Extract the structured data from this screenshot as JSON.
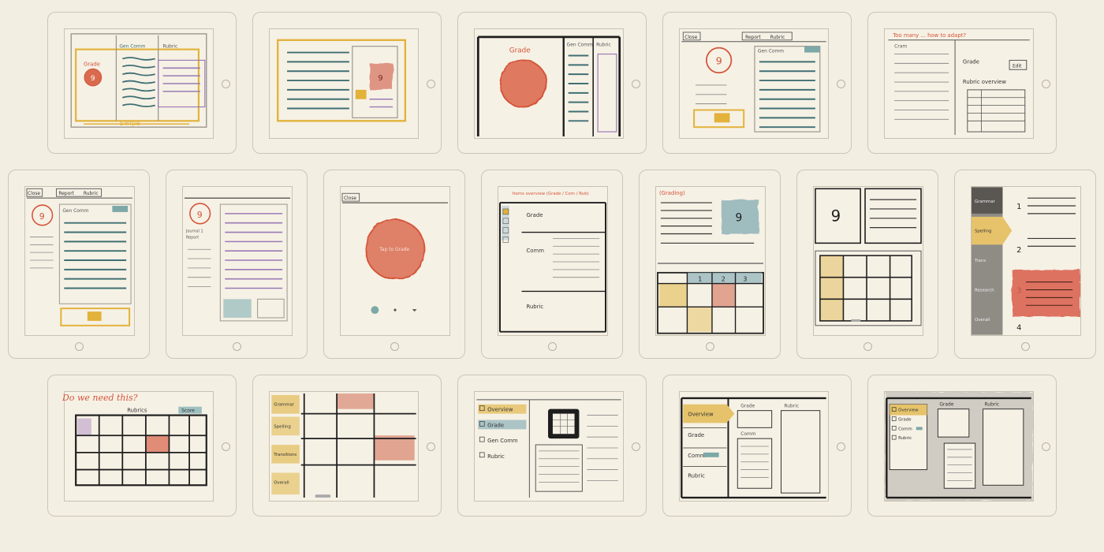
{
  "colors": {
    "background": "#f3eee2",
    "ink": "#2a2a2a",
    "pencil": "#9b968c",
    "teal": "#3f6f73",
    "red": "#d4553a",
    "yellow": "#e2b23a",
    "purple": "#9a7bb5"
  },
  "sketches": {
    "s1": {
      "grade": "Grade",
      "gencomm": "Gen Comm",
      "rubric": "Rubric",
      "score": "9",
      "swipe": "Swipe"
    },
    "s2": {
      "score": "9"
    },
    "s3": {
      "grade": "Grade",
      "gencomm": "Gen Comm",
      "rubric": "Rubric"
    },
    "s4": {
      "close": "Close",
      "report": "Report",
      "rubric": "Rubric",
      "score": "9",
      "gencomm": "Gen Comm"
    },
    "s5": {
      "title": "Too many ... how to adapt?",
      "cram": "Cram",
      "grade": "Grade",
      "edit": "Edit",
      "overview": "Rubric overview"
    },
    "s6": {
      "close": "Close",
      "report": "Report",
      "rubric": "Rubric",
      "score": "9",
      "gencomm": "Gen Comm"
    },
    "s7": {
      "score": "9",
      "tab1": "Journal 1",
      "tab2": "Report"
    },
    "s8": {
      "close": "Close",
      "bubble": "Tap to Grade"
    },
    "s9": {
      "title": "Items overview (Grade / Com / Rub)",
      "grade": "Grade",
      "comm": "Comm",
      "rubric": "Rubric"
    },
    "s10": {
      "title": "(Grading)",
      "score": "9",
      "c1": "1",
      "c2": "2",
      "c3": "3"
    },
    "s11": {
      "score": "9"
    },
    "s12": {
      "n1": "1",
      "n2": "2",
      "n3": "3",
      "n4": "4",
      "rows": [
        "Grammar",
        "Spelling",
        "Trans",
        "Research",
        "Overall"
      ]
    },
    "s13": {
      "question": "Do we need this?",
      "rubric": "Rubrics",
      "tab": "Score"
    },
    "s14": {
      "rows": [
        "Grammar",
        "Spelling",
        "Transitions",
        "Overall"
      ]
    },
    "s15": {
      "items": [
        "Overview",
        "Grade",
        "Gen Comm",
        "Rubric"
      ]
    },
    "s16": {
      "overview": "Overview",
      "grade": "Grade",
      "comm": "Comm",
      "rubric": "Rubric",
      "col1": "Grade",
      "col2": "Rubric",
      "col3": "Comm"
    },
    "s17": {
      "items": [
        "Overview",
        "Grade",
        "Comm",
        "Rubric"
      ],
      "col1": "Grade",
      "col2": "Rubric"
    }
  }
}
